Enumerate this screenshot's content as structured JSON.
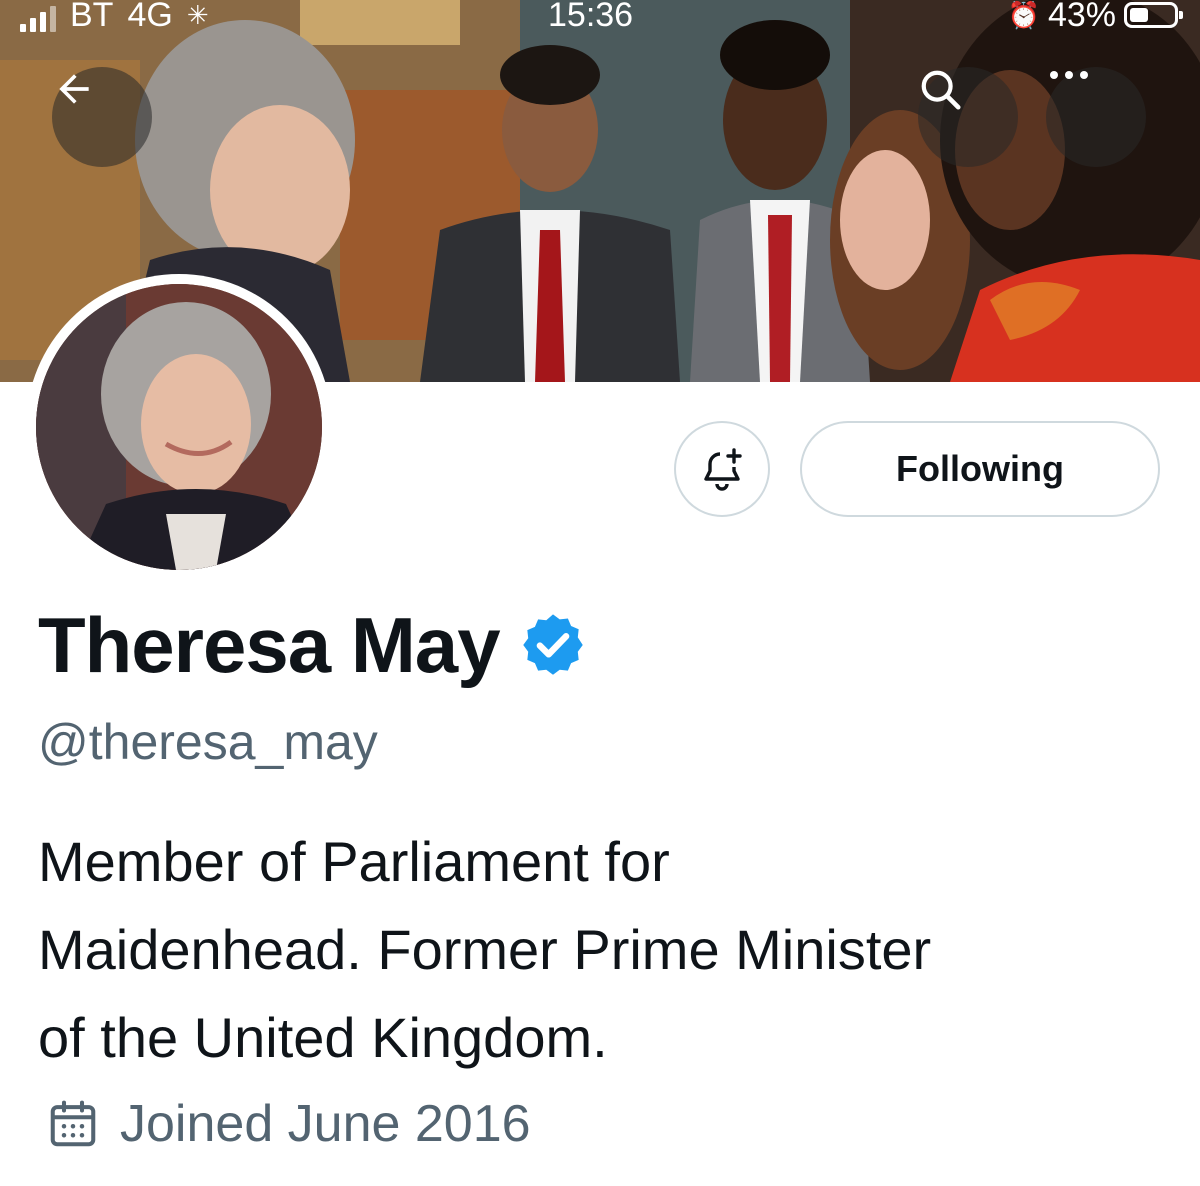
{
  "status_bar": {
    "carrier": "BT",
    "network": "4G",
    "time": "15:36",
    "battery_percent": "43%",
    "battery_level": 0.43
  },
  "header": {
    "back_icon": "arrow-left-icon",
    "search_icon": "search-icon",
    "more_icon": "more-horizontal-icon"
  },
  "profile": {
    "display_name": "Theresa May",
    "verified": true,
    "verified_color": "#1d9bf0",
    "handle": "@theresa_may",
    "bio_lines": [
      "Member of Parliament for",
      "Maidenhead. Former Prime Minister",
      "of the United Kingdom."
    ],
    "joined": "Joined June 2016",
    "joined_icon": "calendar-icon"
  },
  "actions": {
    "notifications_icon": "bell-plus-icon",
    "following_label": "Following"
  },
  "colors": {
    "text_primary": "#0f1419",
    "text_secondary": "#536471",
    "border": "#cfd9de",
    "accent": "#1d9bf0"
  }
}
